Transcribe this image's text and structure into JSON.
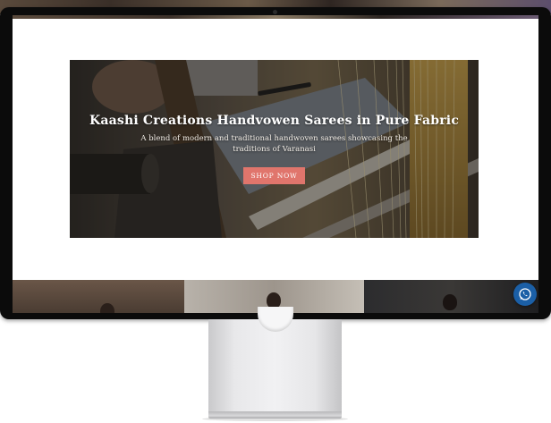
{
  "hero": {
    "title": "Kaashi Creations Handvowen Sarees in Pure Fabric",
    "subtitle": "A blend of modern and traditional handwoven sarees showcasing the traditions of Varanasi",
    "button_label": "SHOP NOW",
    "button_color": "#e0756c"
  },
  "floating": {
    "whatsapp_icon": "whatsapp-icon",
    "whatsapp_color": "#1b5fa6"
  },
  "colors": {
    "monitor_bezel": "#0b0b0b",
    "stand": "#e8e8ea"
  }
}
